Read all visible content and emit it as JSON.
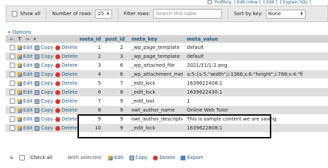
{
  "top_cut": {
    "profiling": "Profiling",
    "edit_inline": "[ Edit inline ]",
    "edit": "[ Edit ]",
    "explain": "[ Explain SQL ]"
  },
  "toolbar": {
    "show_all": "Show all",
    "rows_label": "Number of rows:",
    "rows_value": "25",
    "filter_label": "Filter rows:",
    "filter_placeholder": "Search this table",
    "sort_label": "Sort by key:",
    "sort_value": "None"
  },
  "options_link": "+ Options",
  "columns": [
    "meta_id",
    "post_id",
    "meta_key",
    "meta_value"
  ],
  "actions": {
    "edit": "Edit",
    "copy": "Copy",
    "delete": "Delete"
  },
  "rows": [
    {
      "meta_id": "1",
      "post_id": "2",
      "meta_key": "_wp_page_template",
      "meta_value": "default"
    },
    {
      "meta_id": "2",
      "post_id": "3",
      "meta_key": "_wp_page_template",
      "meta_value": "default"
    },
    {
      "meta_id": "3",
      "post_id": "6",
      "meta_key": "_wp_attached_file",
      "meta_value": "2021/11/1-2.png"
    },
    {
      "meta_id": "4",
      "post_id": "6",
      "meta_key": "_wp_attachment_metadata",
      "meta_value": "a:5:{s:5:\"width\";i:1366;s:6:\"height\";i:768;s:4:\"fi"
    },
    {
      "meta_id": "5",
      "post_id": "7",
      "meta_key": "_edit_lock",
      "meta_value": "1639622408:1"
    },
    {
      "meta_id": "6",
      "post_id": "8",
      "meta_key": "_edit_lock",
      "meta_value": "1639622430:1"
    },
    {
      "meta_id": "7",
      "post_id": "9",
      "meta_key": "_edit_last",
      "meta_value": "1"
    },
    {
      "meta_id": "8",
      "post_id": "9",
      "meta_key": "owt_author_name",
      "meta_value": "Online Web Tutor"
    },
    {
      "meta_id": "9",
      "post_id": "9",
      "meta_key": "owt_author_description",
      "meta_value": "This is sample content we are saving"
    },
    {
      "meta_id": "10",
      "post_id": "9",
      "meta_key": "_edit_lock",
      "meta_value": "1639622808:1"
    }
  ],
  "footer": {
    "check_all": "Check all",
    "with_selected": "With selected:",
    "edit": "Edit",
    "copy": "Copy",
    "delete": "Delete",
    "export": "Export"
  }
}
